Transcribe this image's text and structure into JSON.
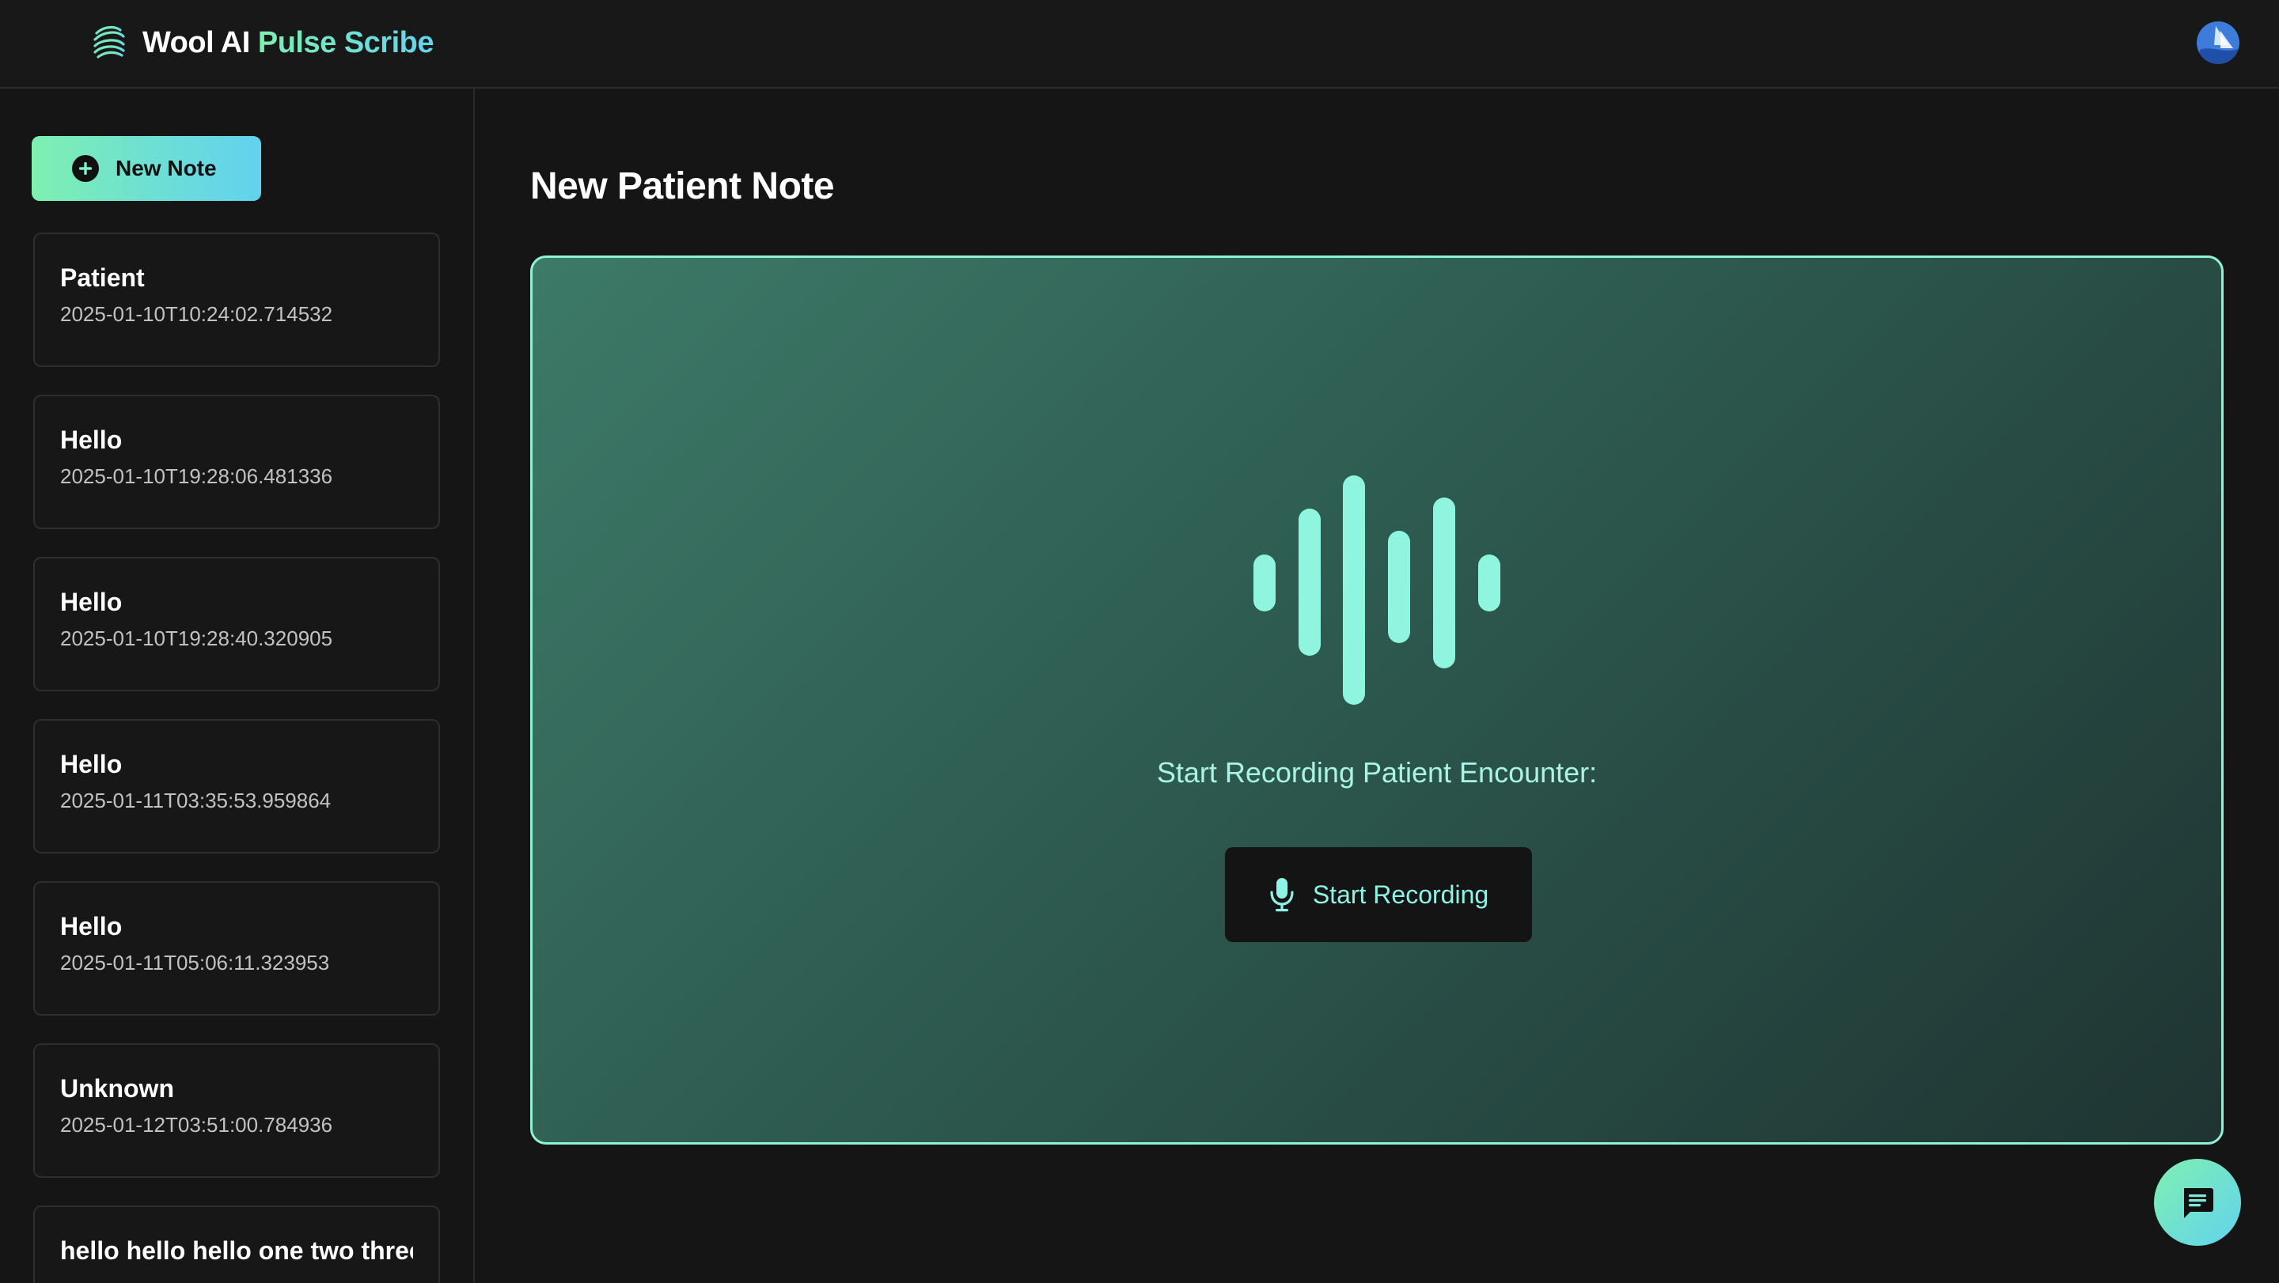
{
  "header": {
    "brand_main": "Wool AI",
    "brand_accent": "Pulse Scribe",
    "logo_icon": "spiral-logo-icon",
    "avatar_icon": "user-avatar-icon"
  },
  "sidebar": {
    "new_note_label": "New Note",
    "new_note_icon": "plus-circle-icon",
    "notes": [
      {
        "title": "Patient",
        "date": "2025-01-10T10:24:02.714532"
      },
      {
        "title": "Hello",
        "date": "2025-01-10T19:28:06.481336"
      },
      {
        "title": "Hello",
        "date": "2025-01-10T19:28:40.320905"
      },
      {
        "title": "Hello",
        "date": "2025-01-11T03:35:53.959864"
      },
      {
        "title": "Hello",
        "date": "2025-01-11T05:06:11.323953"
      },
      {
        "title": "Unknown",
        "date": "2025-01-12T03:51:00.784936"
      },
      {
        "title": "hello hello hello one two three",
        "date": ""
      }
    ]
  },
  "main": {
    "page_title": "New Patient Note",
    "wave_icon": "audio-waveform-icon",
    "record_prompt": "Start Recording Patient Encounter:",
    "start_button_label": "Start Recording",
    "mic_icon": "microphone-icon"
  },
  "chat": {
    "icon": "chat-bubble-icon"
  },
  "colors": {
    "accent_green": "#7ff0b0",
    "accent_cyan": "#62d2ef",
    "panel_border": "#8ef2d3",
    "background": "#151515"
  }
}
